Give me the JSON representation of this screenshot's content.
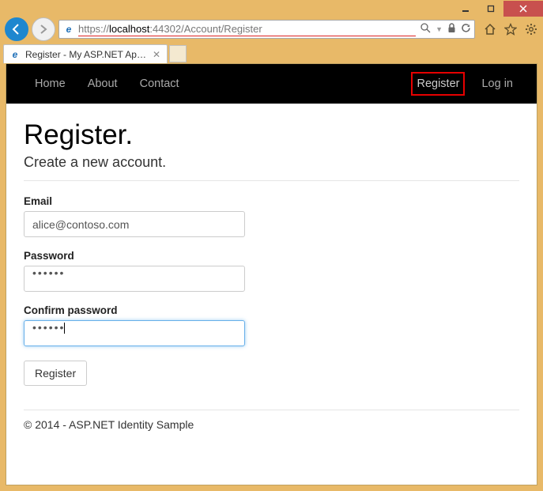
{
  "window": {
    "url_prefix": "https://",
    "url_host": "localhost",
    "url_port": ":44302",
    "url_path": "/Account/Register"
  },
  "tab": {
    "title": "Register - My ASP.NET App..."
  },
  "navbar": {
    "left": [
      "Home",
      "About",
      "Contact"
    ],
    "right": [
      "Register",
      "Log in"
    ],
    "highlighted": "Register"
  },
  "page": {
    "heading": "Register.",
    "subtitle": "Create a new account."
  },
  "form": {
    "email_label": "Email",
    "email_value": "alice@contoso.com",
    "password_label": "Password",
    "password_value": "••••••",
    "confirm_label": "Confirm password",
    "confirm_value": "••••••",
    "submit_label": "Register"
  },
  "footer": {
    "text": "© 2014 - ASP.NET Identity Sample"
  }
}
